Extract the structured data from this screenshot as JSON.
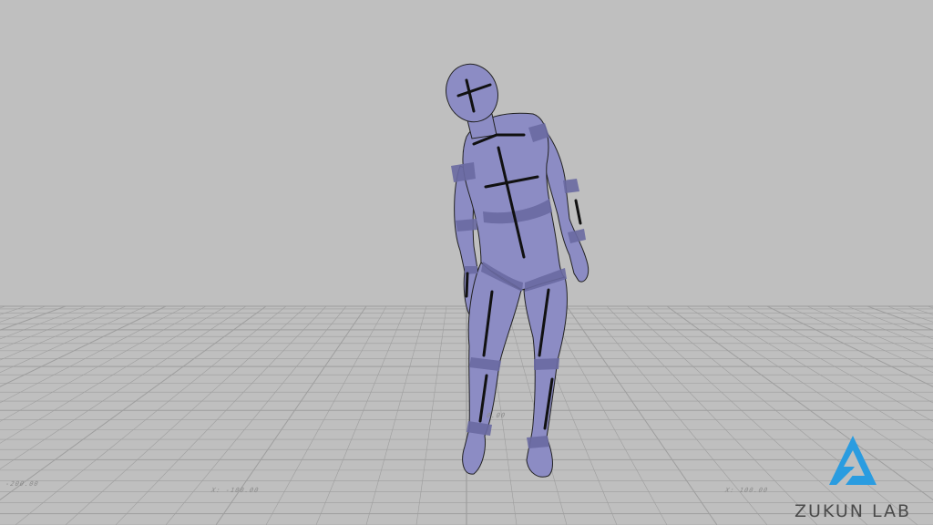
{
  "viewport": {
    "background_color": "#bfbfbf",
    "grid_color": "#9e9e9e",
    "figure_fill": "#8c8cc4",
    "figure_band": "#6a6aa2",
    "marker_color": "#111111"
  },
  "axis_labels": {
    "left": "-200.00",
    "center": "X: -100.00",
    "right": "X: 100.00",
    "mid": "0.00"
  },
  "logo": {
    "text": "ZUKUN LAB",
    "color": "#2a9ce0",
    "icon": "triangle-logo-icon"
  }
}
